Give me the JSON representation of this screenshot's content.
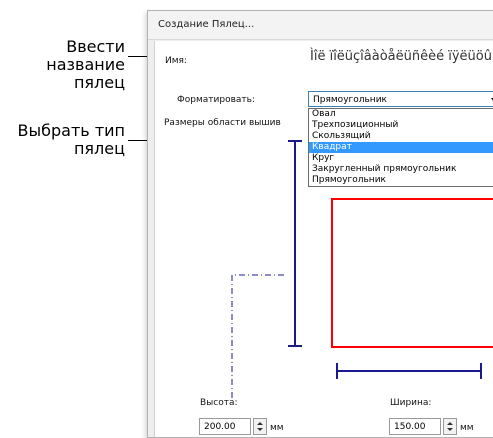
{
  "callouts": {
    "enter_name": [
      "Ввести",
      "название",
      "пялец"
    ],
    "choose_type": [
      "Выбрать тип",
      "пялец"
    ]
  },
  "dialog": {
    "title": "Создание Пялец...",
    "name_label": "Имя:",
    "name_value": "Ìîë ïîëüçîâàòåëüñêèé ïÿëüöû",
    "format_label": "Форматировать:",
    "format_value": "Прямоугольник",
    "sizes_label": "Размеры области вышив",
    "format_options": [
      "Овал",
      "Трехпозиционный",
      "Скользящий",
      "Квадрат",
      "Круг",
      "Закругленный прямоугольник",
      "Прямоугольник"
    ],
    "highlighted_option": "Квадрат",
    "height_label": "Высота:",
    "height_value": "200.00",
    "width_label": "Ширина:",
    "width_value": "150.00",
    "unit": "мм"
  },
  "colors": {
    "dimension_line": "#1a1a8c",
    "hoop_outline": "#ff0000",
    "selection": "#3399ff"
  }
}
